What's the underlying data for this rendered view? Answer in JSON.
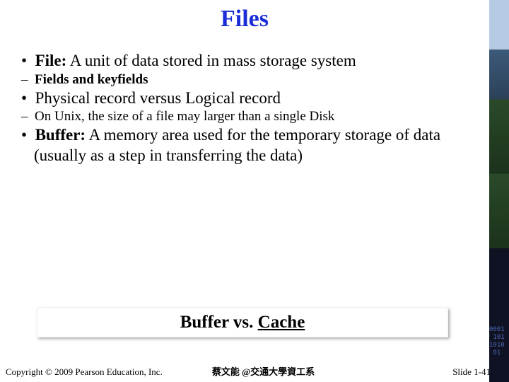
{
  "title": "Files",
  "bullet1": {
    "term": "File:",
    "def": " A unit of data stored in mass storage system",
    "sub": "Fields and keyfields"
  },
  "bullet2": {
    "text": "Physical record versus Logical record",
    "sub": "On Unix, the size of a file may larger than a single Disk"
  },
  "bullet3": {
    "term": "Buffer:",
    "def": " A memory area used for the temporary storage of data (usually as a step in transferring the data)"
  },
  "callout": {
    "lead": "Buffer  vs.  ",
    "cache": "Cache"
  },
  "footer": {
    "copyright": "Copyright © 2009 Pearson Education, Inc.",
    "center": "蔡文能 @交通大學資工系",
    "slide": "Slide 1-41"
  }
}
